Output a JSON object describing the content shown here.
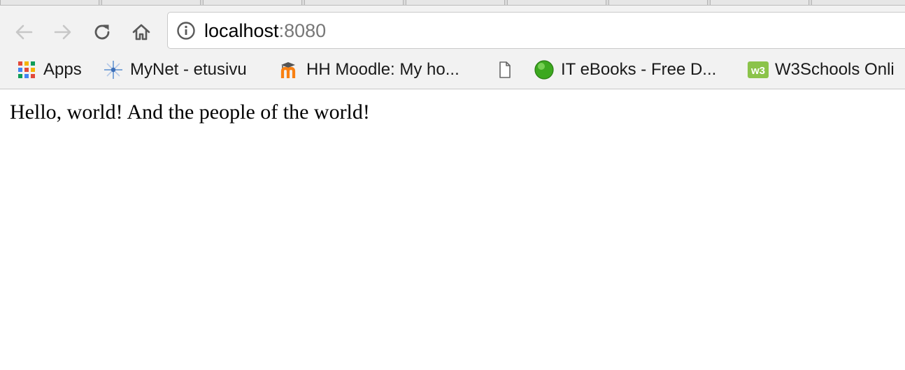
{
  "browser": {
    "address_bar": {
      "host": "localhost",
      "port": ":8080"
    },
    "toolbar_icons": {
      "back": "arrow-left-icon",
      "forward": "arrow-right-icon",
      "reload": "reload-icon",
      "home": "home-icon",
      "site_info": "info-circle-icon"
    },
    "bookmarks": [
      {
        "label": "Apps",
        "icon": "apps-grid-icon"
      },
      {
        "label": "MyNet - etusivu",
        "icon": "mynet-icon"
      },
      {
        "label": "HH Moodle: My ho...",
        "icon": "moodle-icon"
      },
      {
        "label": "",
        "icon": "document-icon"
      },
      {
        "label": "IT eBooks - Free D...",
        "icon": "green-ball-icon"
      },
      {
        "label": "W3Schools Onli",
        "icon": "w3schools-icon"
      }
    ]
  },
  "page": {
    "text": "Hello, world! And the people of the world!"
  },
  "colors": {
    "chrome_background": "#f2f2f2",
    "apps_grid": [
      "#e24a3b",
      "#f4b400",
      "#0f9d58",
      "#4285f4"
    ],
    "moodle_orange": "#f98012",
    "green_ball": "#3ca81f",
    "w3schools_green": "#8bc34a"
  }
}
